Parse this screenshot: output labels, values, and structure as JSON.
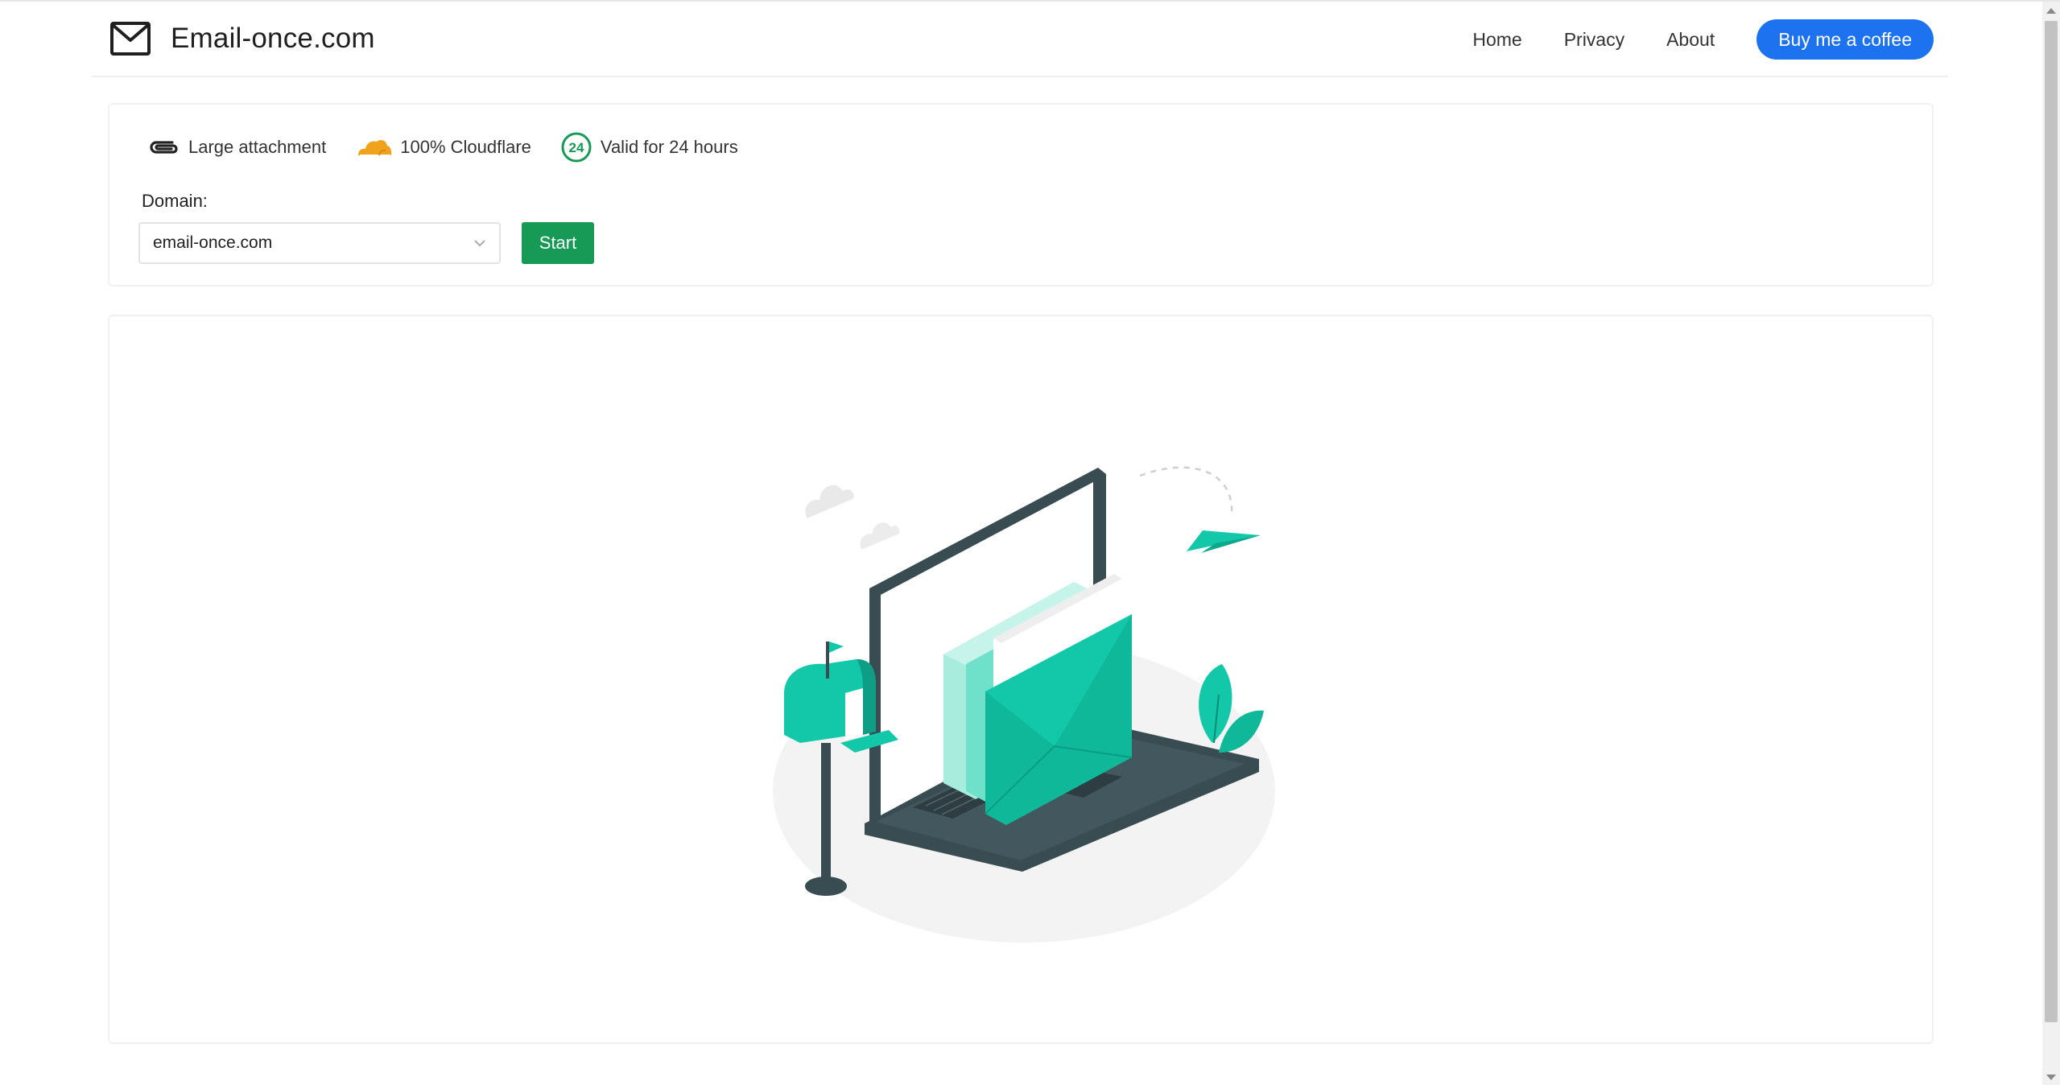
{
  "header": {
    "brand_title": "Email-once.com",
    "nav": {
      "home": "Home",
      "privacy": "Privacy",
      "about": "About"
    },
    "coffee_button": "Buy me a coffee"
  },
  "features": [
    {
      "icon": "paperclip-icon",
      "label": "Large attachment"
    },
    {
      "icon": "cloudflare-icon",
      "label": "100% Cloudflare"
    },
    {
      "icon": "24-hours-icon",
      "label": "Valid for 24 hours"
    }
  ],
  "domain": {
    "label": "Domain:",
    "selected": "email-once.com"
  },
  "start_button": "Start",
  "colors": {
    "accent_blue": "#1d72f0",
    "start_green": "#169a55",
    "illustration_teal": "#12c8a8",
    "cloudflare_orange": "#f0a21c"
  }
}
